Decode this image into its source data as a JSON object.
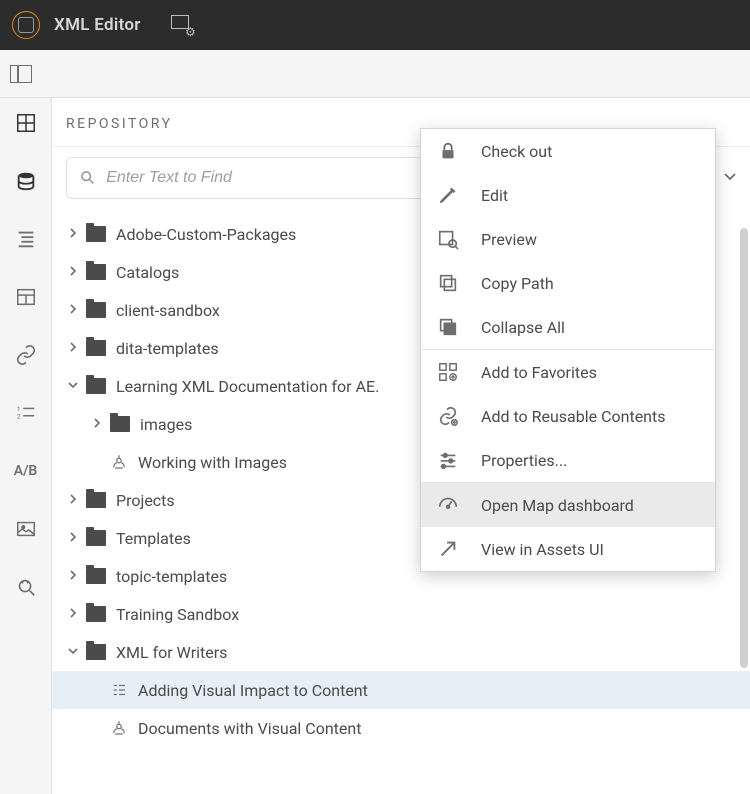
{
  "app_title": "XML Editor",
  "repository_label": "REPOSITORY",
  "search": {
    "placeholder": "Enter Text to Find"
  },
  "tree": [
    {
      "type": "folder",
      "label": "Adobe-Custom-Packages",
      "expanded": false,
      "depth": 0,
      "selected": false
    },
    {
      "type": "folder",
      "label": "Catalogs",
      "expanded": false,
      "depth": 0,
      "selected": false
    },
    {
      "type": "folder",
      "label": "client-sandbox",
      "expanded": false,
      "depth": 0,
      "selected": false
    },
    {
      "type": "folder",
      "label": "dita-templates",
      "expanded": false,
      "depth": 0,
      "selected": false
    },
    {
      "type": "folder",
      "label": "Learning XML Documentation for AE.",
      "expanded": true,
      "depth": 0,
      "selected": false
    },
    {
      "type": "folder",
      "label": "images",
      "expanded": false,
      "depth": 1,
      "selected": false
    },
    {
      "type": "topic",
      "label": "Working with Images",
      "depth": 1,
      "selected": false
    },
    {
      "type": "folder",
      "label": "Projects",
      "expanded": false,
      "depth": 0,
      "selected": false
    },
    {
      "type": "folder",
      "label": "Templates",
      "expanded": false,
      "depth": 0,
      "selected": false
    },
    {
      "type": "folder",
      "label": "topic-templates",
      "expanded": false,
      "depth": 0,
      "selected": false
    },
    {
      "type": "folder",
      "label": "Training Sandbox",
      "expanded": false,
      "depth": 0,
      "selected": false
    },
    {
      "type": "folder",
      "label": "XML for Writers",
      "expanded": true,
      "depth": 0,
      "selected": false
    },
    {
      "type": "map",
      "label": "Adding Visual Impact to Content",
      "depth": 1,
      "selected": true
    },
    {
      "type": "topic",
      "label": "Documents with Visual Content",
      "depth": 1,
      "selected": false
    }
  ],
  "context_menu": {
    "hovered_index": 8,
    "items": [
      {
        "icon": "lock-icon",
        "label": "Check out"
      },
      {
        "icon": "pencil-icon",
        "label": "Edit"
      },
      {
        "icon": "preview-icon",
        "label": "Preview"
      },
      {
        "icon": "copy-path-icon",
        "label": "Copy Path"
      },
      {
        "icon": "collapse-all-icon",
        "label": "Collapse All"
      },
      {
        "sep": true
      },
      {
        "icon": "favorites-add-icon",
        "label": "Add to Favorites"
      },
      {
        "icon": "reusable-add-icon",
        "label": "Add to Reusable Contents"
      },
      {
        "icon": "properties-icon",
        "label": "Properties..."
      },
      {
        "sep": true
      },
      {
        "icon": "dashboard-icon",
        "label": "Open Map dashboard"
      },
      {
        "icon": "open-link-icon",
        "label": "View in Assets UI"
      }
    ]
  }
}
